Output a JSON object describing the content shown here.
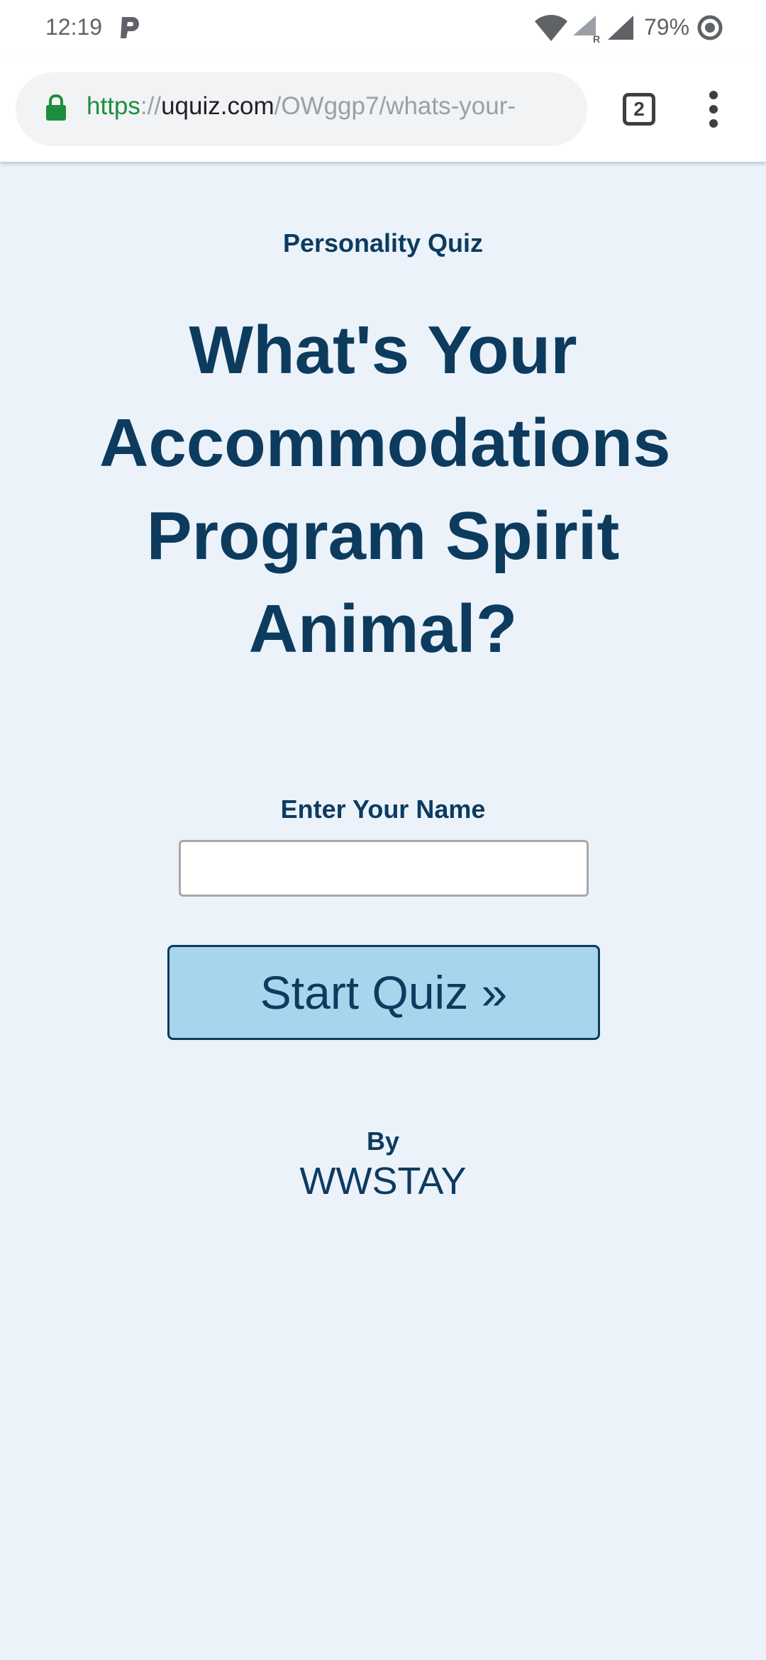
{
  "status_bar": {
    "time": "12:19",
    "battery": "79%",
    "icons": [
      "p-icon",
      "wifi-icon",
      "signal-r-icon",
      "signal-icon",
      "sync-icon"
    ]
  },
  "browser": {
    "url": {
      "scheme": "https",
      "separator": "://",
      "host": "uquiz.com",
      "path": "/OWggp7/whats-your-"
    },
    "tab_count": "2",
    "colors": {
      "secure": "#1e8e3e",
      "host": "#202124",
      "muted": "#9aa0a6"
    }
  },
  "quiz": {
    "type_label": "Personality Quiz",
    "title": "What's Your Accommodations Program Spirit Animal?",
    "name_label": "Enter Your Name",
    "name_value": "",
    "start_button": "Start Quiz »",
    "by_label": "By",
    "author": "WWSTAY"
  },
  "theme": {
    "background": "#ebf2fa",
    "text": "#0d3b5e",
    "button_fill": "#a8d5ee"
  }
}
